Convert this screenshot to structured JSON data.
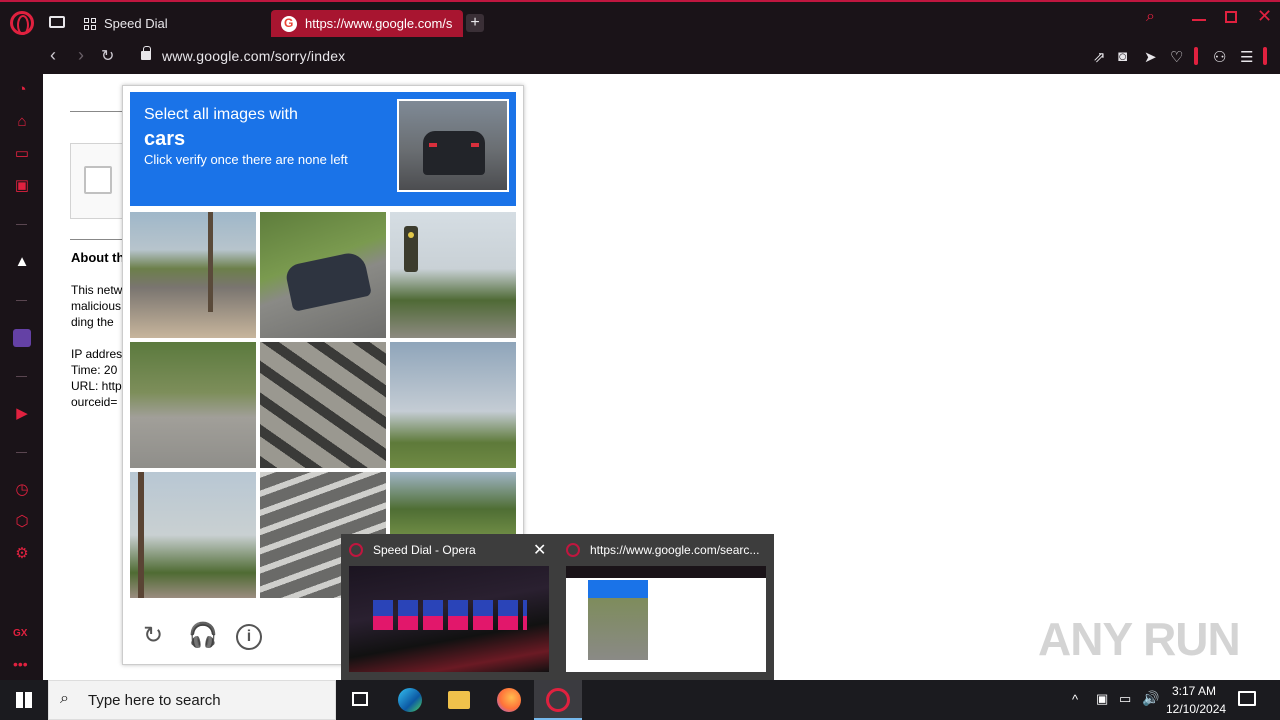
{
  "browser": {
    "tabs": [
      {
        "label": "Speed Dial"
      },
      {
        "label": "https://www.google.com/s"
      }
    ],
    "address": "www.google.com/sorry/index"
  },
  "page": {
    "about_heading": "About th",
    "lines": [
      "This netw",
      "malicious",
      "ding the"
    ],
    "details": [
      "IP addres",
      "Time: 20",
      "URL: http",
      "ourceid="
    ]
  },
  "captcha": {
    "line1": "Select all images with",
    "target": "cars",
    "line3": "Click verify once there are none left"
  },
  "thumbnails": [
    {
      "title": "Speed Dial - Opera"
    },
    {
      "title": "https://www.google.com/searc..."
    }
  ],
  "taskbar": {
    "search_placeholder": "Type here to search",
    "time": "3:17 AM",
    "date": "12/10/2024"
  },
  "watermark": "ANY RUN",
  "sidebar_label": "GX",
  "colors": {
    "accent": "#e0213f",
    "captcha_blue": "#1a73e8",
    "chrome_bg": "#1a1318"
  }
}
